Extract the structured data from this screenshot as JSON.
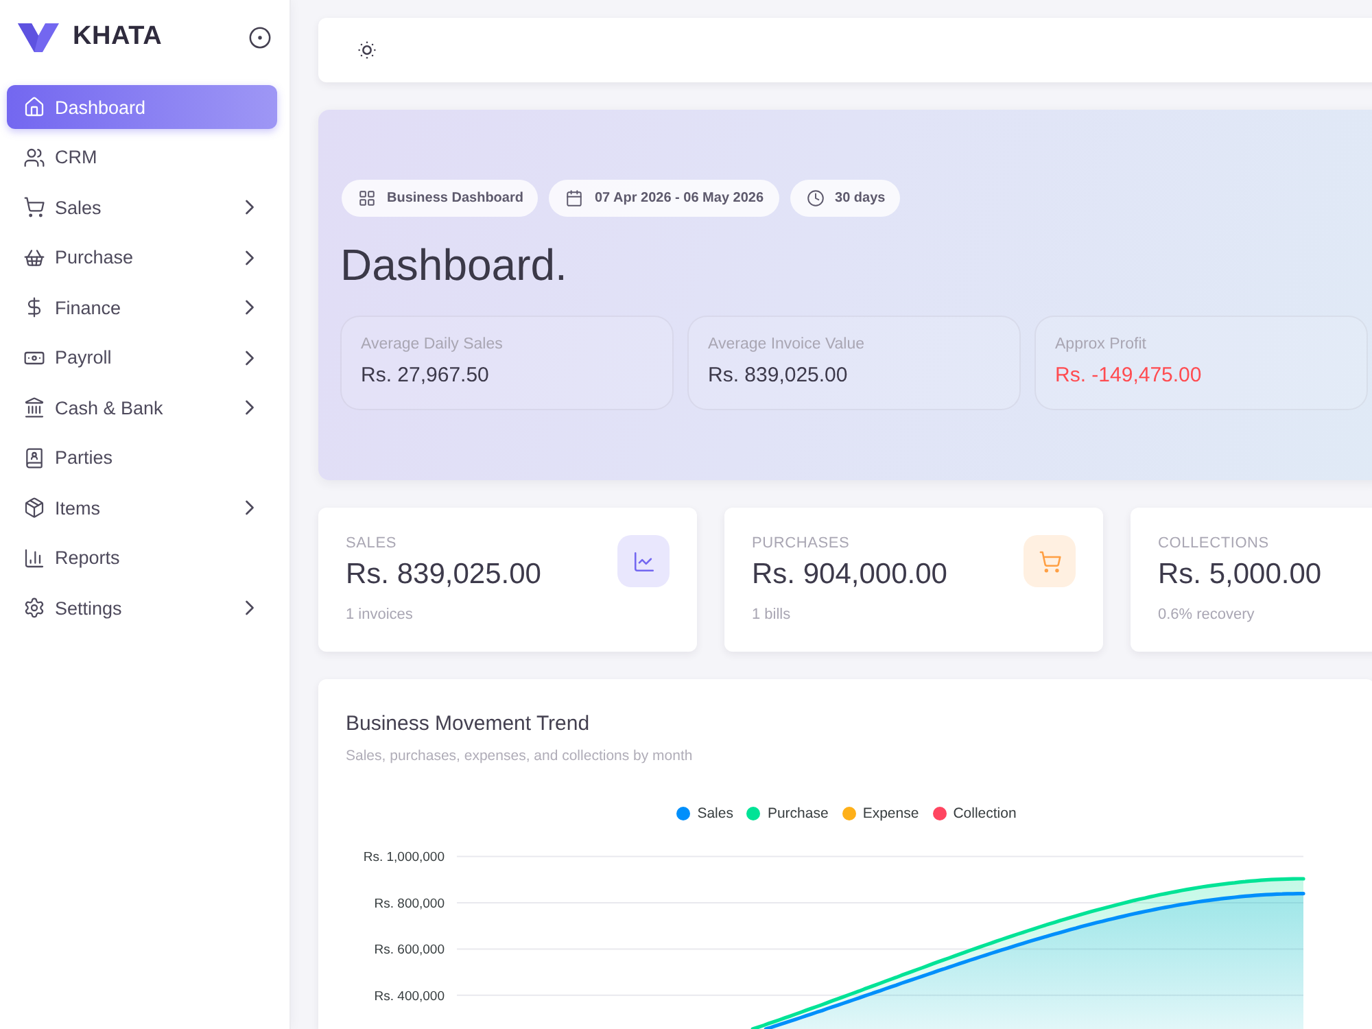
{
  "sidebar": {
    "brand": "KHATA",
    "items": [
      {
        "label": "Dashboard",
        "selected": true,
        "has_submenu": false
      },
      {
        "label": "CRM",
        "selected": false,
        "has_submenu": false
      },
      {
        "label": "Sales",
        "selected": false,
        "has_submenu": true
      },
      {
        "label": "Purchase",
        "selected": false,
        "has_submenu": true
      },
      {
        "label": "Finance",
        "selected": false,
        "has_submenu": true
      },
      {
        "label": "Payroll",
        "selected": false,
        "has_submenu": true
      },
      {
        "label": "Cash & Bank",
        "selected": false,
        "has_submenu": true
      },
      {
        "label": "Parties",
        "selected": false,
        "has_submenu": false
      },
      {
        "label": "Items",
        "selected": false,
        "has_submenu": true
      },
      {
        "label": "Reports",
        "selected": false,
        "has_submenu": false
      },
      {
        "label": "Settings",
        "selected": false,
        "has_submenu": true
      }
    ]
  },
  "hero": {
    "tags": [
      {
        "kind": "section",
        "label": "Business Dashboard"
      },
      {
        "kind": "range",
        "label": "07 Apr 2026 - 06 May 2026"
      },
      {
        "kind": "period",
        "label": "30 days"
      }
    ],
    "title": "Dashboard.",
    "metrics": [
      {
        "label": "Average Daily Sales",
        "value": "Rs. 27,967.50",
        "negative": false
      },
      {
        "label": "Average Invoice Value",
        "value": "Rs. 839,025.00",
        "negative": false
      },
      {
        "label": "Approx Profit",
        "value": "Rs. -149,475.00",
        "negative": true
      }
    ]
  },
  "stats": [
    {
      "kind": "sales",
      "label": "SALES",
      "value": "Rs. 839,025.00",
      "note": "1 invoices"
    },
    {
      "kind": "purchases",
      "label": "PURCHASES",
      "value": "Rs. 904,000.00",
      "note": "1 bills"
    },
    {
      "kind": "collections",
      "label": "COLLECTIONS",
      "value": "Rs. 5,000.00",
      "note": "0.6% recovery"
    }
  ],
  "trend": {
    "title": "Business Movement Trend",
    "subtitle": "Sales, purchases, expenses, and collections by month",
    "legend": [
      {
        "name": "Sales",
        "color": "#008ffb"
      },
      {
        "name": "Purchase",
        "color": "#00e396"
      },
      {
        "name": "Expense",
        "color": "#feb019"
      },
      {
        "name": "Collection",
        "color": "#ff4560"
      }
    ],
    "y_axis_labels": [
      "Rs. 1,000,000",
      "Rs. 800,000",
      "Rs. 600,000",
      "Rs. 400,000"
    ]
  }
}
